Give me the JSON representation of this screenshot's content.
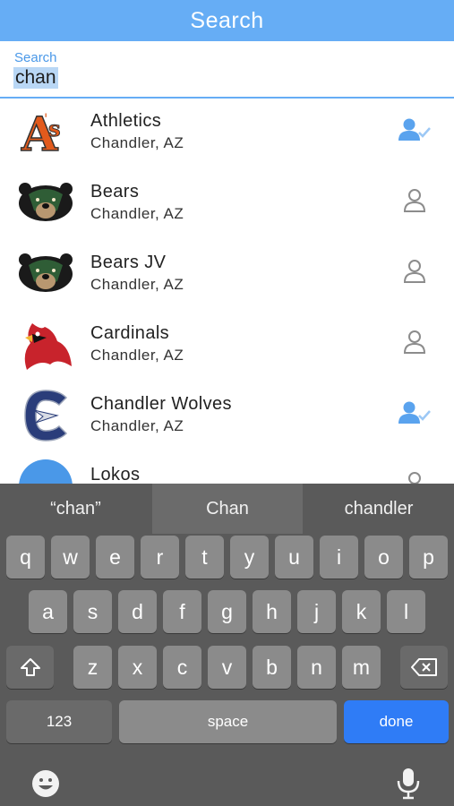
{
  "header": {
    "title": "Search"
  },
  "search": {
    "label": "Search",
    "value": "chan"
  },
  "teams": [
    {
      "name": "Athletics",
      "location": "Chandler, AZ",
      "logo": "athletics-logo",
      "followed": true
    },
    {
      "name": "Bears",
      "location": "Chandler, AZ",
      "logo": "bear-logo",
      "followed": false
    },
    {
      "name": "Bears JV",
      "location": "Chandler, AZ",
      "logo": "bear-logo",
      "followed": false
    },
    {
      "name": "Cardinals",
      "location": "Chandler, AZ",
      "logo": "cardinal-logo",
      "followed": false
    },
    {
      "name": "Chandler Wolves",
      "location": "Chandler, AZ",
      "logo": "wolves-logo",
      "followed": true
    },
    {
      "name": "Lokos",
      "location": "",
      "logo": "lokos-logo",
      "followed": false
    }
  ],
  "colors": {
    "accent": "#66adf5",
    "follow_active": "#5aa3ee",
    "follow_inactive": "#8c8c8c",
    "done": "#2f7cf6"
  },
  "keyboard": {
    "suggestions": [
      "“chan”",
      "Chan",
      "chandler"
    ],
    "row1": [
      "q",
      "w",
      "e",
      "r",
      "t",
      "y",
      "u",
      "i",
      "o",
      "p"
    ],
    "row2": [
      "a",
      "s",
      "d",
      "f",
      "g",
      "h",
      "j",
      "k",
      "l"
    ],
    "row3": [
      "z",
      "x",
      "c",
      "v",
      "b",
      "n",
      "m"
    ],
    "numbers_label": "123",
    "space_label": "space",
    "done_label": "done"
  }
}
